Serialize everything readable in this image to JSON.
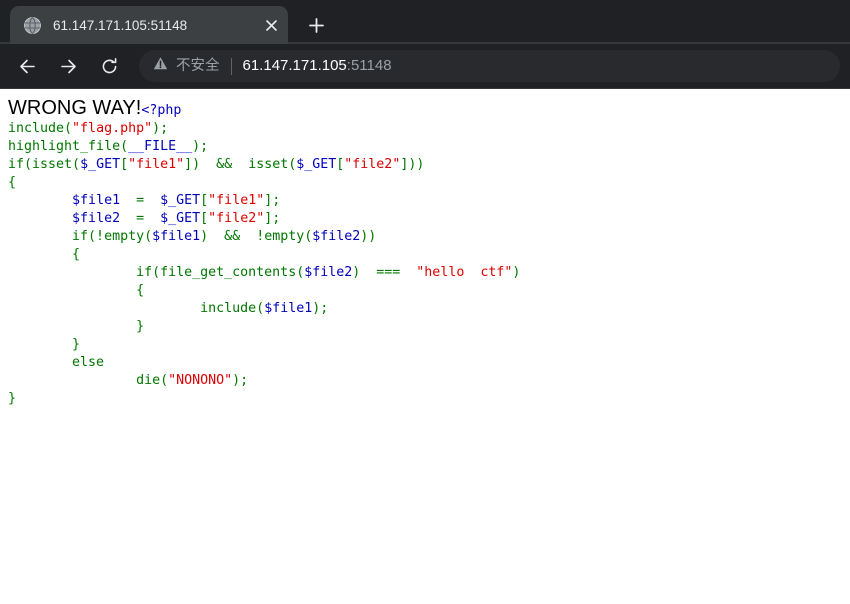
{
  "browser": {
    "tab": {
      "title": "61.147.171.105:51148",
      "favicon_icon": "globe-icon",
      "close_icon": "close-icon"
    },
    "new_tab_icon": "plus-icon",
    "toolbar": {
      "back_icon": "arrow-left-icon",
      "forward_icon": "arrow-right-icon",
      "reload_icon": "reload-icon",
      "security": {
        "icon": "warning-triangle-icon",
        "label": "不安全"
      },
      "url_host": "61.147.171.105",
      "url_port": ":51148"
    },
    "colors": {
      "chrome_bg": "#202124",
      "tab_active_bg": "#3c4043",
      "omnibox_bg": "#292a2d",
      "tab_text": "#e8eaed",
      "muted_text": "#9aa0a6"
    }
  },
  "page": {
    "heading": "WRONG WAY!",
    "php_open_tag": "<?php",
    "colors": {
      "keyword": "#007700",
      "variable": "#0000BB",
      "string": "#DD0000",
      "default": "#000000",
      "background": "#ffffff"
    },
    "code_lines": [
      [
        {
          "t": "include(",
          "c": "kw"
        },
        {
          "t": "\"flag.php\"",
          "c": "str"
        },
        {
          "t": ");",
          "c": "kw"
        }
      ],
      [
        {
          "t": "highlight_file(",
          "c": "kw"
        },
        {
          "t": "__FILE__",
          "c": "var"
        },
        {
          "t": ");",
          "c": "kw"
        }
      ],
      [
        {
          "t": "if(isset(",
          "c": "kw"
        },
        {
          "t": "$_GET",
          "c": "var"
        },
        {
          "t": "[",
          "c": "kw"
        },
        {
          "t": "\"file1\"",
          "c": "str"
        },
        {
          "t": "])  &&  isset(",
          "c": "kw"
        },
        {
          "t": "$_GET",
          "c": "var"
        },
        {
          "t": "[",
          "c": "kw"
        },
        {
          "t": "\"file2\"",
          "c": "str"
        },
        {
          "t": "]))",
          "c": "kw"
        }
      ],
      [
        {
          "t": "{",
          "c": "kw"
        }
      ],
      [
        {
          "t": "        ",
          "c": "kw"
        },
        {
          "t": "$file1",
          "c": "var"
        },
        {
          "t": "  =  ",
          "c": "kw"
        },
        {
          "t": "$_GET",
          "c": "var"
        },
        {
          "t": "[",
          "c": "kw"
        },
        {
          "t": "\"file1\"",
          "c": "str"
        },
        {
          "t": "];",
          "c": "kw"
        }
      ],
      [
        {
          "t": "        ",
          "c": "kw"
        },
        {
          "t": "$file2",
          "c": "var"
        },
        {
          "t": "  =  ",
          "c": "kw"
        },
        {
          "t": "$_GET",
          "c": "var"
        },
        {
          "t": "[",
          "c": "kw"
        },
        {
          "t": "\"file2\"",
          "c": "str"
        },
        {
          "t": "];",
          "c": "kw"
        }
      ],
      [
        {
          "t": "        if(!empty(",
          "c": "kw"
        },
        {
          "t": "$file1",
          "c": "var"
        },
        {
          "t": ")  &&  !empty(",
          "c": "kw"
        },
        {
          "t": "$file2",
          "c": "var"
        },
        {
          "t": "))",
          "c": "kw"
        }
      ],
      [
        {
          "t": "        {",
          "c": "kw"
        }
      ],
      [
        {
          "t": "                if(file_get_contents(",
          "c": "kw"
        },
        {
          "t": "$file2",
          "c": "var"
        },
        {
          "t": ")  ===  ",
          "c": "kw"
        },
        {
          "t": "\"hello  ctf\"",
          "c": "str"
        },
        {
          "t": ")",
          "c": "kw"
        }
      ],
      [
        {
          "t": "                {",
          "c": "kw"
        }
      ],
      [
        {
          "t": "                        include(",
          "c": "kw"
        },
        {
          "t": "$file1",
          "c": "var"
        },
        {
          "t": ");",
          "c": "kw"
        }
      ],
      [
        {
          "t": "                }",
          "c": "kw"
        }
      ],
      [
        {
          "t": "        }",
          "c": "kw"
        }
      ],
      [
        {
          "t": "        else",
          "c": "kw"
        }
      ],
      [
        {
          "t": "                die(",
          "c": "kw"
        },
        {
          "t": "\"NONONO\"",
          "c": "str"
        },
        {
          "t": ");",
          "c": "kw"
        }
      ],
      [
        {
          "t": "}",
          "c": "kw"
        }
      ]
    ]
  }
}
